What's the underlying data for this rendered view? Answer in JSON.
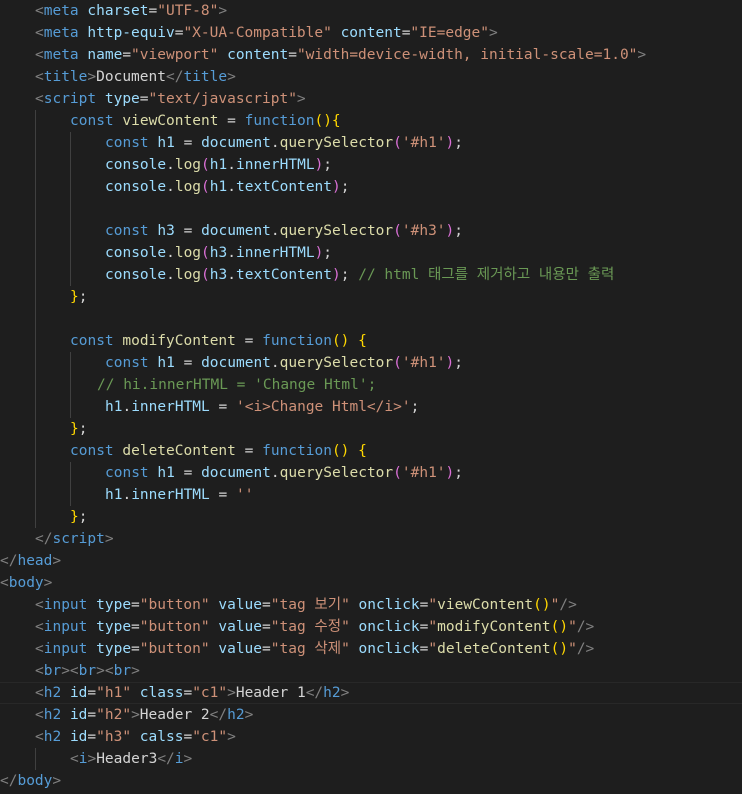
{
  "editor": {
    "theme": {
      "background": "#1e1e1e",
      "tag": "#569cd6",
      "attribute": "#9cdcfe",
      "string": "#ce9178",
      "function": "#dcdcaa",
      "comment": "#6a9955",
      "punctuation": "#808080",
      "bracket_gold": "#ffd700",
      "bracket_purple": "#da70d6"
    },
    "active_line_index": 31,
    "lines": [
      {
        "indent": 1,
        "tokens": [
          [
            "p",
            "<"
          ],
          [
            "t",
            "meta"
          ],
          [
            "o",
            " "
          ],
          [
            "a",
            "charset"
          ],
          [
            "o",
            "="
          ],
          [
            "s",
            "\"UTF-8\""
          ],
          [
            "p",
            ">"
          ]
        ]
      },
      {
        "indent": 1,
        "tokens": [
          [
            "p",
            "<"
          ],
          [
            "t",
            "meta"
          ],
          [
            "o",
            " "
          ],
          [
            "a",
            "http-equiv"
          ],
          [
            "o",
            "="
          ],
          [
            "s",
            "\"X-UA-Compatible\""
          ],
          [
            "o",
            " "
          ],
          [
            "a",
            "content"
          ],
          [
            "o",
            "="
          ],
          [
            "s",
            "\"IE=edge\""
          ],
          [
            "p",
            ">"
          ]
        ]
      },
      {
        "indent": 1,
        "tokens": [
          [
            "p",
            "<"
          ],
          [
            "t",
            "meta"
          ],
          [
            "o",
            " "
          ],
          [
            "a",
            "name"
          ],
          [
            "o",
            "="
          ],
          [
            "s",
            "\"viewport\""
          ],
          [
            "o",
            " "
          ],
          [
            "a",
            "content"
          ],
          [
            "o",
            "="
          ],
          [
            "s",
            "\"width=device-width, initial-scale=1.0\""
          ],
          [
            "p",
            ">"
          ]
        ]
      },
      {
        "indent": 1,
        "tokens": [
          [
            "p",
            "<"
          ],
          [
            "t",
            "title"
          ],
          [
            "p",
            ">"
          ],
          [
            "o",
            "Document"
          ],
          [
            "p",
            "</"
          ],
          [
            "t",
            "title"
          ],
          [
            "p",
            ">"
          ]
        ]
      },
      {
        "indent": 1,
        "tokens": [
          [
            "p",
            "<"
          ],
          [
            "t",
            "script"
          ],
          [
            "o",
            " "
          ],
          [
            "a",
            "type"
          ],
          [
            "o",
            "="
          ],
          [
            "s",
            "\"text/javascript\""
          ],
          [
            "p",
            ">"
          ]
        ]
      },
      {
        "indent": 2,
        "tokens": [
          [
            "k",
            "const"
          ],
          [
            "o",
            " "
          ],
          [
            "f",
            "viewContent"
          ],
          [
            "o",
            " = "
          ],
          [
            "k",
            "function"
          ],
          [
            "y",
            "(){"
          ]
        ]
      },
      {
        "indent": 3,
        "tokens": [
          [
            "k",
            "const"
          ],
          [
            "o",
            " "
          ],
          [
            "v",
            "h1"
          ],
          [
            "o",
            " = "
          ],
          [
            "v",
            "document"
          ],
          [
            "o",
            "."
          ],
          [
            "f",
            "querySelector"
          ],
          [
            "m",
            "("
          ],
          [
            "s",
            "'#h1'"
          ],
          [
            "m",
            ")"
          ],
          [
            "o",
            ";"
          ]
        ]
      },
      {
        "indent": 3,
        "tokens": [
          [
            "v",
            "console"
          ],
          [
            "o",
            "."
          ],
          [
            "f",
            "log"
          ],
          [
            "m",
            "("
          ],
          [
            "v",
            "h1"
          ],
          [
            "o",
            "."
          ],
          [
            "v",
            "innerHTML"
          ],
          [
            "m",
            ")"
          ],
          [
            "o",
            ";"
          ]
        ]
      },
      {
        "indent": 3,
        "tokens": [
          [
            "v",
            "console"
          ],
          [
            "o",
            "."
          ],
          [
            "f",
            "log"
          ],
          [
            "m",
            "("
          ],
          [
            "v",
            "h1"
          ],
          [
            "o",
            "."
          ],
          [
            "v",
            "textContent"
          ],
          [
            "m",
            ")"
          ],
          [
            "o",
            ";"
          ]
        ]
      },
      {
        "indent": 3,
        "tokens": []
      },
      {
        "indent": 3,
        "tokens": [
          [
            "k",
            "const"
          ],
          [
            "o",
            " "
          ],
          [
            "v",
            "h3"
          ],
          [
            "o",
            " = "
          ],
          [
            "v",
            "document"
          ],
          [
            "o",
            "."
          ],
          [
            "f",
            "querySelector"
          ],
          [
            "m",
            "("
          ],
          [
            "s",
            "'#h3'"
          ],
          [
            "m",
            ")"
          ],
          [
            "o",
            ";"
          ]
        ]
      },
      {
        "indent": 3,
        "tokens": [
          [
            "v",
            "console"
          ],
          [
            "o",
            "."
          ],
          [
            "f",
            "log"
          ],
          [
            "m",
            "("
          ],
          [
            "v",
            "h3"
          ],
          [
            "o",
            "."
          ],
          [
            "v",
            "innerHTML"
          ],
          [
            "m",
            ")"
          ],
          [
            "o",
            ";"
          ]
        ]
      },
      {
        "indent": 3,
        "tokens": [
          [
            "v",
            "console"
          ],
          [
            "o",
            "."
          ],
          [
            "f",
            "log"
          ],
          [
            "m",
            "("
          ],
          [
            "v",
            "h3"
          ],
          [
            "o",
            "."
          ],
          [
            "v",
            "textContent"
          ],
          [
            "m",
            ")"
          ],
          [
            "o",
            "; "
          ],
          [
            "c",
            "// html 태그를 제거하고 내용만 출력"
          ]
        ]
      },
      {
        "indent": 2,
        "tokens": [
          [
            "y",
            "}"
          ],
          [
            "o",
            ";"
          ]
        ]
      },
      {
        "indent": 2,
        "tokens": []
      },
      {
        "indent": 2,
        "tokens": [
          [
            "k",
            "const"
          ],
          [
            "o",
            " "
          ],
          [
            "f",
            "modifyContent"
          ],
          [
            "o",
            " = "
          ],
          [
            "k",
            "function"
          ],
          [
            "y",
            "()"
          ],
          [
            "o",
            " "
          ],
          [
            "y",
            "{"
          ]
        ]
      },
      {
        "indent": 3,
        "tokens": [
          [
            "k",
            "const"
          ],
          [
            "o",
            " "
          ],
          [
            "v",
            "h1"
          ],
          [
            "o",
            " = "
          ],
          [
            "v",
            "document"
          ],
          [
            "o",
            "."
          ],
          [
            "f",
            "querySelector"
          ],
          [
            "m",
            "("
          ],
          [
            "s",
            "'#h1'"
          ],
          [
            "m",
            ")"
          ],
          [
            "o",
            ";"
          ]
        ]
      },
      {
        "indent": 3,
        "offset": -1,
        "tokens": [
          [
            "c",
            "// hi.innerHTML = 'Change Html';"
          ]
        ]
      },
      {
        "indent": 3,
        "tokens": [
          [
            "v",
            "h1"
          ],
          [
            "o",
            "."
          ],
          [
            "v",
            "innerHTML"
          ],
          [
            "o",
            " = "
          ],
          [
            "s",
            "'<i>Change Html</i>'"
          ],
          [
            "o",
            ";"
          ]
        ]
      },
      {
        "indent": 2,
        "tokens": [
          [
            "y",
            "}"
          ],
          [
            "o",
            ";"
          ]
        ]
      },
      {
        "indent": 2,
        "tokens": [
          [
            "k",
            "const"
          ],
          [
            "o",
            " "
          ],
          [
            "f",
            "deleteContent"
          ],
          [
            "o",
            " = "
          ],
          [
            "k",
            "function"
          ],
          [
            "y",
            "()"
          ],
          [
            "o",
            " "
          ],
          [
            "y",
            "{"
          ]
        ]
      },
      {
        "indent": 3,
        "tokens": [
          [
            "k",
            "const"
          ],
          [
            "o",
            " "
          ],
          [
            "v",
            "h1"
          ],
          [
            "o",
            " = "
          ],
          [
            "v",
            "document"
          ],
          [
            "o",
            "."
          ],
          [
            "f",
            "querySelector"
          ],
          [
            "m",
            "("
          ],
          [
            "s",
            "'#h1'"
          ],
          [
            "m",
            ")"
          ],
          [
            "o",
            ";"
          ]
        ]
      },
      {
        "indent": 3,
        "tokens": [
          [
            "v",
            "h1"
          ],
          [
            "o",
            "."
          ],
          [
            "v",
            "innerHTML"
          ],
          [
            "o",
            " = "
          ],
          [
            "s",
            "''"
          ]
        ]
      },
      {
        "indent": 2,
        "tokens": [
          [
            "y",
            "}"
          ],
          [
            "o",
            ";"
          ]
        ]
      },
      {
        "indent": 1,
        "tokens": [
          [
            "p",
            "</"
          ],
          [
            "t",
            "script"
          ],
          [
            "p",
            ">"
          ]
        ]
      },
      {
        "indent": 0,
        "tokens": [
          [
            "p",
            "</"
          ],
          [
            "t",
            "head"
          ],
          [
            "p",
            ">"
          ]
        ]
      },
      {
        "indent": 0,
        "tokens": [
          [
            "p",
            "<"
          ],
          [
            "t",
            "body"
          ],
          [
            "p",
            ">"
          ]
        ]
      },
      {
        "indent": 1,
        "tokens": [
          [
            "p",
            "<"
          ],
          [
            "t",
            "input"
          ],
          [
            "o",
            " "
          ],
          [
            "a",
            "type"
          ],
          [
            "o",
            "="
          ],
          [
            "s",
            "\"button\""
          ],
          [
            "o",
            " "
          ],
          [
            "a",
            "value"
          ],
          [
            "o",
            "="
          ],
          [
            "s",
            "\"tag 보기\""
          ],
          [
            "o",
            " "
          ],
          [
            "a",
            "onclick"
          ],
          [
            "o",
            "="
          ],
          [
            "s",
            "\""
          ],
          [
            "f",
            "viewContent"
          ],
          [
            "y",
            "()"
          ],
          [
            "s",
            "\""
          ],
          [
            "p",
            "/>"
          ]
        ]
      },
      {
        "indent": 1,
        "tokens": [
          [
            "p",
            "<"
          ],
          [
            "t",
            "input"
          ],
          [
            "o",
            " "
          ],
          [
            "a",
            "type"
          ],
          [
            "o",
            "="
          ],
          [
            "s",
            "\"button\""
          ],
          [
            "o",
            " "
          ],
          [
            "a",
            "value"
          ],
          [
            "o",
            "="
          ],
          [
            "s",
            "\"tag 수정\""
          ],
          [
            "o",
            " "
          ],
          [
            "a",
            "onclick"
          ],
          [
            "o",
            "="
          ],
          [
            "s",
            "\""
          ],
          [
            "f",
            "modifyContent"
          ],
          [
            "y",
            "()"
          ],
          [
            "s",
            "\""
          ],
          [
            "p",
            "/>"
          ]
        ]
      },
      {
        "indent": 1,
        "tokens": [
          [
            "p",
            "<"
          ],
          [
            "t",
            "input"
          ],
          [
            "o",
            " "
          ],
          [
            "a",
            "type"
          ],
          [
            "o",
            "="
          ],
          [
            "s",
            "\"button\""
          ],
          [
            "o",
            " "
          ],
          [
            "a",
            "value"
          ],
          [
            "o",
            "="
          ],
          [
            "s",
            "\"tag 삭제\""
          ],
          [
            "o",
            " "
          ],
          [
            "a",
            "onclick"
          ],
          [
            "o",
            "="
          ],
          [
            "s",
            "\""
          ],
          [
            "f",
            "deleteContent"
          ],
          [
            "y",
            "()"
          ],
          [
            "s",
            "\""
          ],
          [
            "p",
            "/>"
          ]
        ]
      },
      {
        "indent": 1,
        "tokens": [
          [
            "p",
            "<"
          ],
          [
            "t",
            "br"
          ],
          [
            "p",
            "><"
          ],
          [
            "t",
            "br"
          ],
          [
            "p",
            "><"
          ],
          [
            "t",
            "br"
          ],
          [
            "p",
            ">"
          ]
        ]
      },
      {
        "indent": 1,
        "tokens": [
          [
            "p",
            "<"
          ],
          [
            "t",
            "h2"
          ],
          [
            "o",
            " "
          ],
          [
            "a",
            "id"
          ],
          [
            "o",
            "="
          ],
          [
            "s",
            "\"h1\""
          ],
          [
            "o",
            " "
          ],
          [
            "a",
            "class"
          ],
          [
            "o",
            "="
          ],
          [
            "s",
            "\"c1\""
          ],
          [
            "p",
            ">"
          ],
          [
            "o",
            "Header 1"
          ],
          [
            "p",
            "</"
          ],
          [
            "t",
            "h2"
          ],
          [
            "p",
            ">"
          ]
        ]
      },
      {
        "indent": 1,
        "tokens": [
          [
            "p",
            "<"
          ],
          [
            "t",
            "h2"
          ],
          [
            "o",
            " "
          ],
          [
            "a",
            "id"
          ],
          [
            "o",
            "="
          ],
          [
            "s",
            "\"h2\""
          ],
          [
            "p",
            ">"
          ],
          [
            "o",
            "Header 2"
          ],
          [
            "p",
            "</"
          ],
          [
            "t",
            "h2"
          ],
          [
            "p",
            ">"
          ]
        ]
      },
      {
        "indent": 1,
        "tokens": [
          [
            "p",
            "<"
          ],
          [
            "t",
            "h2"
          ],
          [
            "o",
            " "
          ],
          [
            "a",
            "id"
          ],
          [
            "o",
            "="
          ],
          [
            "s",
            "\"h3\""
          ],
          [
            "o",
            " "
          ],
          [
            "a",
            "calss"
          ],
          [
            "o",
            "="
          ],
          [
            "s",
            "\"c1\""
          ],
          [
            "p",
            ">"
          ]
        ]
      },
      {
        "indent": 2,
        "tokens": [
          [
            "p",
            "<"
          ],
          [
            "t",
            "i"
          ],
          [
            "p",
            ">"
          ],
          [
            "o",
            "Header3"
          ],
          [
            "p",
            "</"
          ],
          [
            "t",
            "i"
          ],
          [
            "p",
            ">"
          ]
        ]
      },
      {
        "indent": 0,
        "tokens": [
          [
            "p",
            "</"
          ],
          [
            "t",
            "body"
          ],
          [
            "p",
            ">"
          ]
        ]
      }
    ]
  }
}
